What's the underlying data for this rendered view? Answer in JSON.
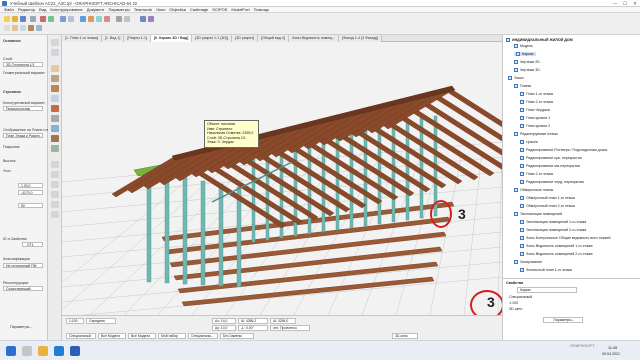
{
  "window": {
    "title": "Учебный Шаблон AC22_А3С.tpl - GRAPHISOFT ARCHICAD-64 22",
    "minimize": "—",
    "maximize": "☐",
    "close": "✕"
  },
  "menu": [
    "Файл",
    "Редактор",
    "Вид",
    "Конструирование",
    "Документ",
    "Параметры",
    "Teamwork",
    "Окно",
    "Objectica",
    "Cadimage",
    "SCIPOS",
    "ModelPort",
    "Помощь"
  ],
  "tabs": [
    {
      "label": "[1. План 1-го этажа]"
    },
    {
      "label": "[1. Вид 1]"
    },
    {
      "label": "[Разрез 1-1]"
    },
    {
      "label": "[0. Каркас 3D / Вид]",
      "active": true
    },
    {
      "label": "[3D разрез 1-1 (3D)]"
    },
    {
      "label": "[3D разрез]"
    },
    {
      "label": "[Общий вид 4]"
    },
    {
      "label": "Зоны Ведомость помещ..."
    },
    {
      "label": "[Фасад 1-4 (3 Фасад)]"
    }
  ],
  "infobox": {
    "selection": "Основное",
    "layer_label": "Слой:",
    "layer_value": "3D-Стропилла 1/1",
    "geometry_label": "Геометрический вариант:",
    "element_label": "Стропила:",
    "structure_label": "Конструктивный вариант:",
    "profile_label": "Прямоугольник",
    "section_label": "Отображение на Плане и в Разрезе:",
    "floorplan_value": "План Этажа и Разрез...",
    "surface_label": "Покрытия:",
    "height_label": "Высота:",
    "angle_label": "Угол:",
    "offset_value": "1,00,0",
    "ref_value": "-4170,0",
    "width_value": "50",
    "id_label": "ID и Свойства:",
    "id_value": "_ОТ1",
    "class_label": "Классификация:",
    "class_value": "Не стропилный ПМ",
    "renovation_label": "Реконструкция:",
    "renovation_value": "Существующий",
    "params_label": "Параметры..."
  },
  "tooltip": {
    "lines": [
      "Объект: пиломат",
      "Имя: Стропило",
      "Начальная Отметка: 2395,0",
      "Слой: 3D-Стропила 1/1",
      "Этаж: 0. Чердак"
    ]
  },
  "annotations": {
    "marker_left": "3",
    "marker_right": "3"
  },
  "navigator": {
    "project": "ИНДИВИДУАЛЬНЫЙ ЖИЛОЙ ДОМ",
    "items": [
      {
        "label": "Модель",
        "level": 1
      },
      {
        "label": "Каркас",
        "level": 1,
        "selected": true
      },
      {
        "label": "Чертежи 2D",
        "level": 1
      },
      {
        "label": "Чертежи 3D",
        "level": 1
      },
      {
        "label": "Эскиз",
        "level": 0
      },
      {
        "label": "Планы",
        "level": 1
      },
      {
        "label": "План 1-го этажа",
        "level": 2
      },
      {
        "label": "План 2-го этажа",
        "level": 2
      },
      {
        "label": "План Чердака",
        "level": 2
      },
      {
        "label": "План кровли 1",
        "level": 2
      },
      {
        "label": "План кровли 2",
        "level": 2
      },
      {
        "label": "Редактируемые планы",
        "level": 1
      },
      {
        "label": "Цоколь",
        "level": 2
      },
      {
        "label": "Редактирование Ростверк / Подкладочная доска",
        "level": 2
      },
      {
        "label": "Редактирование цок. перекрытия",
        "level": 2
      },
      {
        "label": "Редактирование мж перекрытия",
        "level": 2
      },
      {
        "label": "План 2-го этажа",
        "level": 2
      },
      {
        "label": "Редактирование черд. перекрытия",
        "level": 2
      },
      {
        "label": "Обмерочные планы",
        "level": 1
      },
      {
        "label": "Обмерочный план 1-го этажа",
        "level": 2
      },
      {
        "label": "Обмерочный план 2-го этажа",
        "level": 2
      },
      {
        "label": "Экспликация помещений",
        "level": 1
      },
      {
        "label": "Экспликация помещений 1-го этажа",
        "level": 2
      },
      {
        "label": "Экспликация помещений 2-го этажа",
        "level": 2
      },
      {
        "label": "Зоны Контрольные Общие ведомость всех этажей",
        "level": 2
      },
      {
        "label": "Зоны Ведомость помещений 1-го этажа",
        "level": 2
      },
      {
        "label": "Зоны Ведомость помещений 2-го этажа",
        "level": 2
      },
      {
        "label": "Зонирование",
        "level": 1
      },
      {
        "label": "Зональный план 1-го этажа",
        "level": 2
      }
    ],
    "properties_title": "Свойства",
    "prop_name": "Каркас",
    "prop_special": "Специальный",
    "prop_scale": "1:100",
    "prop_view": "3D-окно",
    "params_button": "Параметры..."
  },
  "statusbar": {
    "zoom": "1:100",
    "model_view": "Все Модели",
    "layer_combo": "Специальный",
    "pen_set": "Все Модели",
    "struct": "Мой набор",
    "dim": "Специальны...",
    "renovation": "Без Замены",
    "view_label": "3D-окно",
    "coord_dx": "Δх: 14,0",
    "coord_dy": "Δy: 10,0",
    "coord_a": "Δl: 4286,2",
    "coord_ang": "∠: 0,00°",
    "coord_r": "Δl: 3256,0",
    "project_zero": "отн. Проектнου",
    "mode": "Середина"
  },
  "taskbar": {
    "time": "11:45",
    "date": "09.04.2021",
    "graphisoft": "GRAPHISOFT"
  },
  "colors": {
    "rafter": "#8a4a2a",
    "rafter_dark": "#6b3620",
    "frame": "#6fb7b0",
    "frame_dark": "#4b918a",
    "sill": "#7ab23a",
    "floor_board": "#9b5a36",
    "grid": "#c8c8c8",
    "accent": "#2f6ec8"
  }
}
